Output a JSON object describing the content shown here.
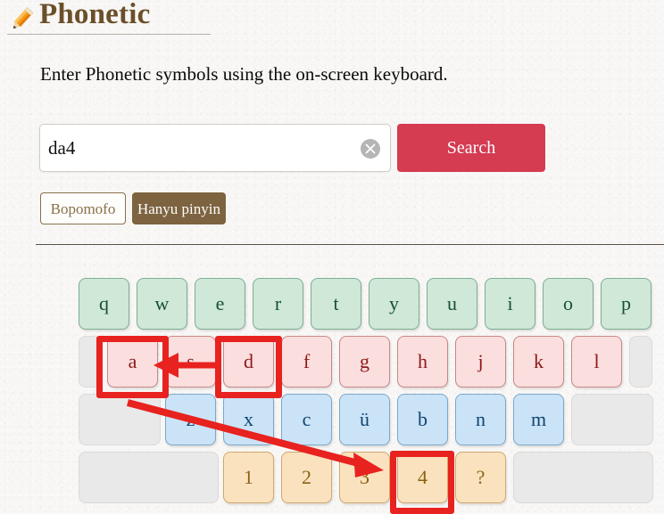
{
  "header": {
    "title": "Phonetic",
    "icon": "pencil-icon"
  },
  "instruction": "Enter Phonetic symbols using the on-screen keyboard.",
  "search": {
    "value": "da4",
    "placeholder": "",
    "clear_icon": "clear-circle-x-icon",
    "button_label": "Search",
    "button_color": "#d53b51"
  },
  "tabs": {
    "inactive_label": "Bopomofo",
    "active_label": "Hanyu pinyin",
    "active_color": "#7d6340",
    "inactive_color": "#8a7048"
  },
  "keyboard": {
    "row1": [
      {
        "label": "q"
      },
      {
        "label": "w"
      },
      {
        "label": "e"
      },
      {
        "label": "r"
      },
      {
        "label": "t"
      },
      {
        "label": "y"
      },
      {
        "label": "u"
      },
      {
        "label": "i"
      },
      {
        "label": "o"
      },
      {
        "label": "p"
      }
    ],
    "row2": [
      {
        "label": "a"
      },
      {
        "label": "s"
      },
      {
        "label": "d"
      },
      {
        "label": "f"
      },
      {
        "label": "g"
      },
      {
        "label": "h"
      },
      {
        "label": "j"
      },
      {
        "label": "k"
      },
      {
        "label": "l"
      }
    ],
    "row3": [
      {
        "label": "z"
      },
      {
        "label": "x"
      },
      {
        "label": "c"
      },
      {
        "label": "ü"
      },
      {
        "label": "b"
      },
      {
        "label": "n"
      },
      {
        "label": "m"
      }
    ],
    "row4": [
      {
        "label": "1"
      },
      {
        "label": "2"
      },
      {
        "label": "3"
      },
      {
        "label": "4"
      },
      {
        "label": "?"
      }
    ],
    "colors": {
      "row1": "#cfe8d8",
      "row2": "#fbdede",
      "row3": "#cbe3f7",
      "row4": "#fbe2bf",
      "blank": "#e9e9e9"
    }
  },
  "annotations": {
    "highlight_color": "#e8221f",
    "highlighted_keys": [
      "a",
      "d",
      "4"
    ],
    "arrows": [
      {
        "from": "d",
        "to": "a"
      },
      {
        "from": "a",
        "to": "4"
      }
    ]
  }
}
